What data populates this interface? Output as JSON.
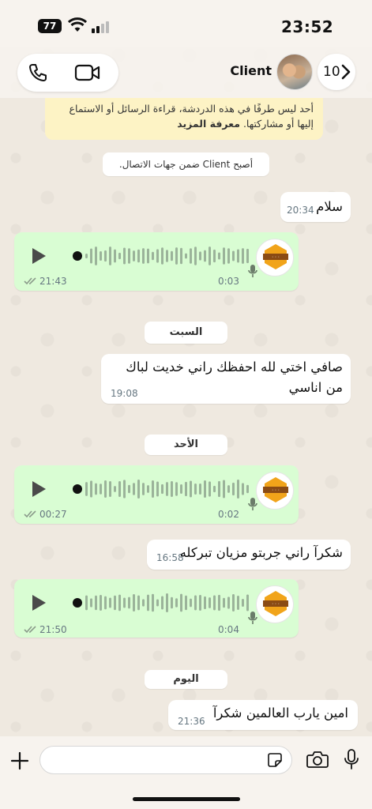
{
  "status_bar": {
    "time": "23:52",
    "battery": "77"
  },
  "header": {
    "contact_name": "Client",
    "back_count": "10",
    "icons": {
      "call": "phone-icon",
      "video": "video-icon",
      "back": "chevron-right-icon"
    }
  },
  "notice": {
    "text": "أحد ليس طرفًا في هذه الدردشة، قراءة الرسائل أو الاستماع إليها أو مشاركتها.",
    "link": "معرفة المزيد"
  },
  "system_message": "أصبح Client ضمن جهات الاتصال.",
  "dates": {
    "saturday": "السبت",
    "sunday": "الأحد",
    "today": "اليوم"
  },
  "messages": [
    {
      "type": "text",
      "direction": "in",
      "text": "سلام",
      "time": "20:34"
    },
    {
      "type": "voice",
      "direction": "out",
      "duration": "0:03",
      "time": "21:43"
    },
    {
      "type": "text",
      "direction": "in",
      "text": "صافي اختي لله احفظك راني خديت لباك من اناسي",
      "time": "19:08"
    },
    {
      "type": "voice",
      "direction": "out",
      "duration": "0:02",
      "time": "00:27"
    },
    {
      "type": "text",
      "direction": "in",
      "text": "شكرآ راني جربتو مزيان تبركله",
      "time": "16:58"
    },
    {
      "type": "voice",
      "direction": "out",
      "duration": "0:04",
      "time": "21:50"
    },
    {
      "type": "text",
      "direction": "in",
      "text": "امين يارب العالمين شكرآ",
      "time": "21:36"
    }
  ],
  "composer": {
    "placeholder": "",
    "icons": {
      "plus": "plus-icon",
      "sticker": "sticker-icon",
      "camera": "camera-icon",
      "mic": "microphone-icon"
    }
  },
  "colors": {
    "outgoing_bubble": "#d9fdd3",
    "incoming_bubble": "#ffffff",
    "notice_bg": "#fdf3c5",
    "wallpaper": "#efe9e0"
  }
}
